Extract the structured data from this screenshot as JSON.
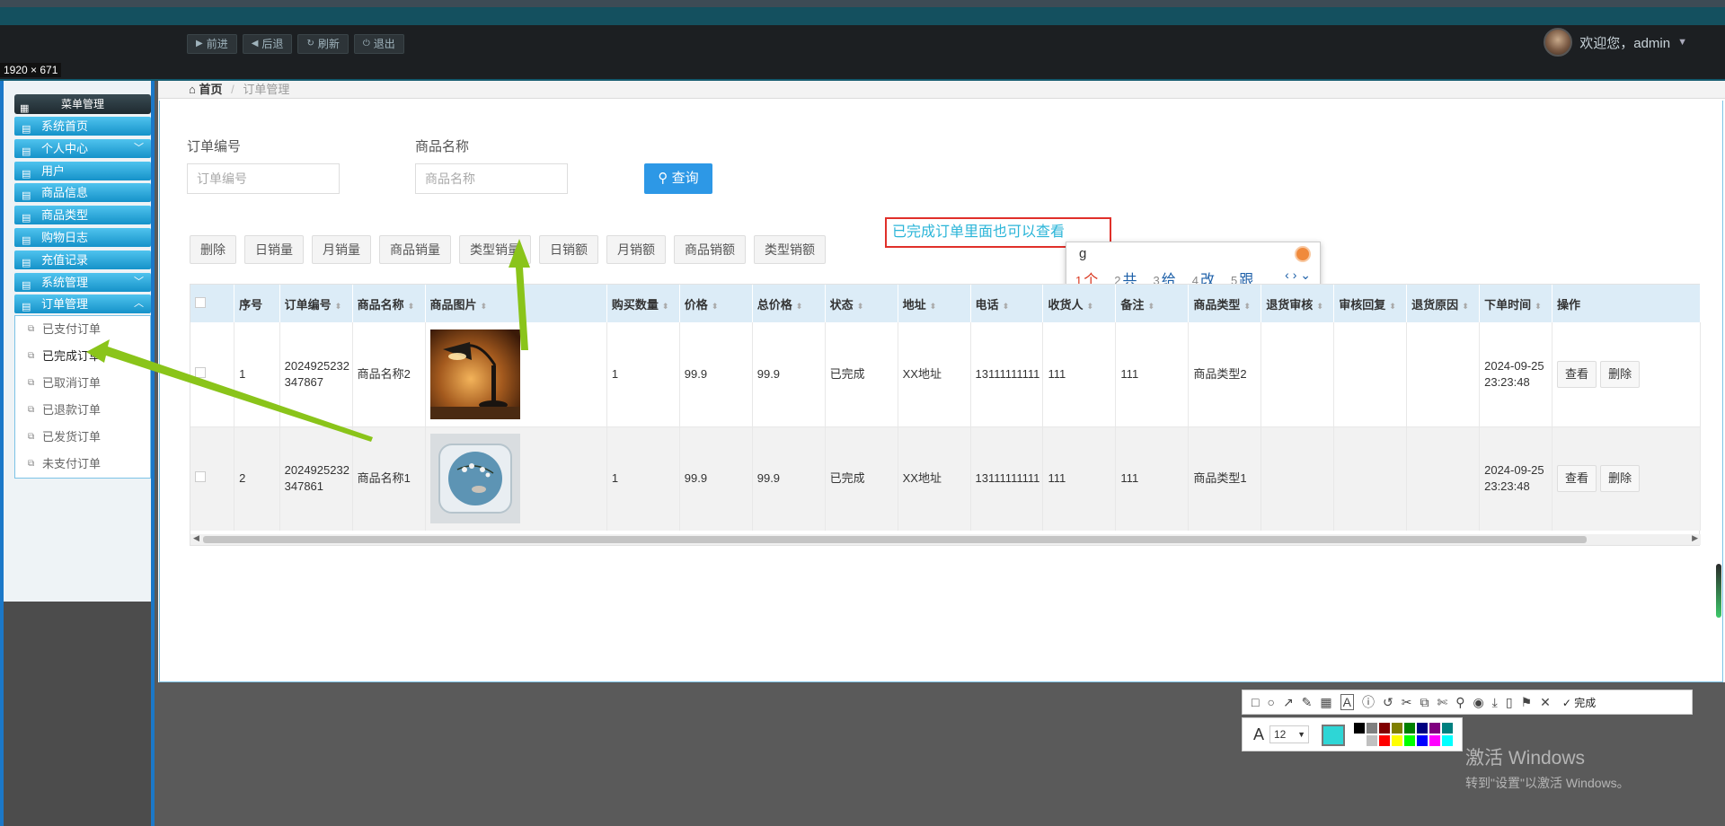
{
  "topnav": {
    "buttons": [
      {
        "icon": "play-icon",
        "label": "前进"
      },
      {
        "icon": "back-icon",
        "label": "后退"
      },
      {
        "icon": "refresh-icon",
        "label": "刷新"
      },
      {
        "icon": "power-icon",
        "label": "退出"
      }
    ],
    "welcome": "欢迎您，admin"
  },
  "selection_label": "1920 × 671",
  "sidebar": {
    "title": "菜单管理",
    "items": [
      {
        "label": "系统首页"
      },
      {
        "label": "个人中心"
      },
      {
        "label": "用户"
      },
      {
        "label": "商品信息"
      },
      {
        "label": "商品类型"
      },
      {
        "label": "购物日志"
      },
      {
        "label": "充值记录"
      },
      {
        "label": "系统管理"
      },
      {
        "label": "订单管理"
      }
    ],
    "submenu": [
      {
        "label": "已支付订单"
      },
      {
        "label": "已完成订单"
      },
      {
        "label": "已取消订单"
      },
      {
        "label": "已退款订单"
      },
      {
        "label": "已发货订单"
      },
      {
        "label": "未支付订单"
      }
    ]
  },
  "breadcrumb": {
    "home": "首页",
    "current": "订单管理"
  },
  "search": {
    "order_no_label": "订单编号",
    "order_no_placeholder": "订单编号",
    "product_label": "商品名称",
    "product_placeholder": "商品名称",
    "query_button": "查询"
  },
  "actions": [
    "删除",
    "日销量",
    "月销量",
    "商品销量",
    "类型销量",
    "日销额",
    "月销额",
    "商品销额",
    "类型销额"
  ],
  "annotation": "已完成订单里面也可以查看",
  "ime": {
    "input": "g",
    "candidates": [
      {
        "n": "1",
        "text": "个"
      },
      {
        "n": "2",
        "text": "共"
      },
      {
        "n": "3",
        "text": "给"
      },
      {
        "n": "4",
        "text": "改"
      },
      {
        "n": "5",
        "text": "跟"
      }
    ]
  },
  "table": {
    "columns": [
      "序号",
      "订单编号",
      "商品名称",
      "商品图片",
      "购买数量",
      "价格",
      "总价格",
      "状态",
      "地址",
      "电话",
      "收货人",
      "备注",
      "商品类型",
      "退货审核",
      "审核回复",
      "退货原因",
      "下单时间",
      "操作"
    ],
    "rows": [
      {
        "idx": "1",
        "order_no": "2024925232347867",
        "product": "商品名称2",
        "image": "desk-lamp-image",
        "qty": "1",
        "price": "99.9",
        "total": "99.9",
        "status": "已完成",
        "address": "XX地址",
        "phone": "13111111111",
        "receiver": "111",
        "remark": "111",
        "type": "商品类型2",
        "return_audit": "",
        "audit_reply": "",
        "return_reason": "",
        "time": "2024-09-25 23:23:48"
      },
      {
        "idx": "2",
        "order_no": "2024925232347861",
        "product": "商品名称1",
        "image": "pillow-image",
        "qty": "1",
        "price": "99.9",
        "total": "99.9",
        "status": "已完成",
        "address": "XX地址",
        "phone": "13111111111",
        "receiver": "111",
        "remark": "111",
        "type": "商品类型1",
        "return_audit": "",
        "audit_reply": "",
        "return_reason": "",
        "time": "2024-09-25 23:23:48"
      }
    ],
    "view_label": "查看",
    "delete_label": "删除"
  },
  "snaptool": {
    "done_label": "完成",
    "font_size": "12",
    "current_color": "#2ed6d6",
    "palette": [
      "#000000",
      "#808080",
      "#800000",
      "#808000",
      "#008000",
      "#000080",
      "#800080",
      "#008080",
      "#ffffff",
      "#c0c0c0",
      "#ff0000",
      "#ffff00",
      "#00ff00",
      "#0000ff",
      "#ff00ff",
      "#00ffff"
    ]
  },
  "watermark": {
    "line1": "激活 Windows",
    "line2": "转到\"设置\"以激活 Windows。"
  }
}
